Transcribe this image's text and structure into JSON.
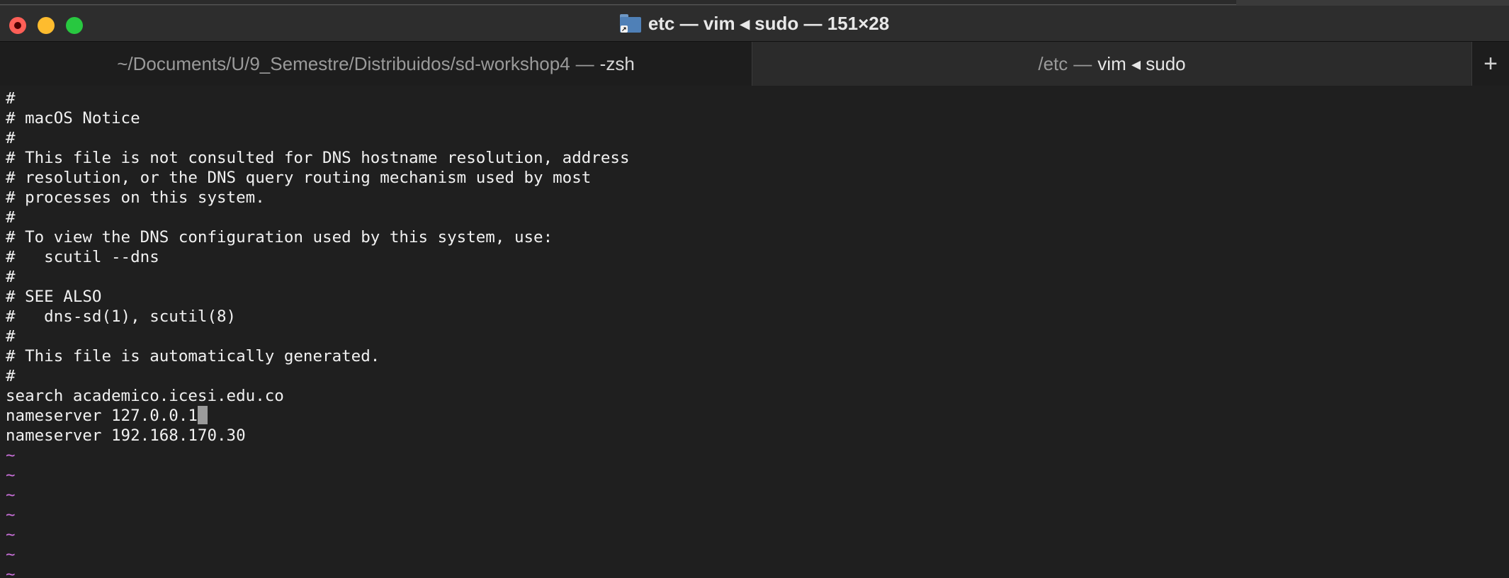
{
  "window": {
    "title": "etc — vim ◂ sudo — 151×28",
    "new_tab_label": "+"
  },
  "tabs": [
    {
      "path": "~/Documents/U/9_Semestre/Distribuidos/sd-workshop4",
      "separator": "—",
      "process": "-zsh",
      "active": false
    },
    {
      "path": "/etc",
      "separator": "—",
      "process": "vim ◂ sudo",
      "active": true
    }
  ],
  "editor": {
    "lines": [
      "#",
      "# macOS Notice",
      "#",
      "# This file is not consulted for DNS hostname resolution, address",
      "# resolution, or the DNS query routing mechanism used by most",
      "# processes on this system.",
      "#",
      "# To view the DNS configuration used by this system, use:",
      "#   scutil --dns",
      "#",
      "# SEE ALSO",
      "#   dns-sd(1), scutil(8)",
      "#",
      "# This file is automatically generated.",
      "#",
      "search academico.icesi.edu.co",
      "nameserver 127.0.0.1",
      "nameserver 192.168.170.30"
    ],
    "empty_lines": [
      "~",
      "~",
      "~",
      "~",
      "~",
      "~",
      "~"
    ]
  },
  "colors": {
    "background": "#1f1f1f",
    "tilde": "#c86fd8",
    "close": "#ff5f57",
    "minimize": "#febc2e",
    "zoom": "#28c840"
  },
  "icons": {
    "title_icon": "folder-icon"
  }
}
